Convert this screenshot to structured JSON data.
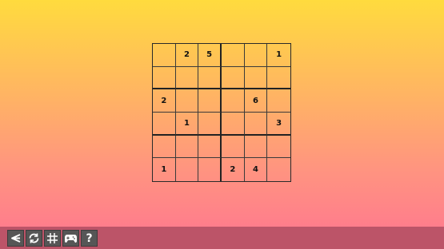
{
  "grid": {
    "size": 6,
    "box_cols": 3,
    "box_rows": 2,
    "cells": [
      [
        "",
        "2",
        "5",
        "",
        "",
        "1"
      ],
      [
        "",
        "",
        "",
        "",
        "",
        ""
      ],
      [
        "2",
        "",
        "",
        "",
        "6",
        ""
      ],
      [
        "",
        "1",
        "",
        "",
        "",
        "3"
      ],
      [
        "",
        "",
        "",
        "",
        "",
        ""
      ],
      [
        "1",
        "",
        "",
        "2",
        "4",
        ""
      ]
    ]
  },
  "toolbar": {
    "buttons": [
      {
        "icon": "back-arrow-icon",
        "name": "back-button"
      },
      {
        "icon": "restart-icon",
        "name": "restart-button"
      },
      {
        "icon": "grid-icon",
        "name": "grid-button"
      },
      {
        "icon": "gamepad-icon",
        "name": "games-button"
      },
      {
        "icon": "help-icon",
        "name": "help-button",
        "label": "?"
      }
    ]
  },
  "colors": {
    "gradient_top": "#ffdb3e",
    "gradient_bottom": "#ff7590",
    "toolbar_bg": "#bc5468",
    "button_bg": "#565656"
  }
}
